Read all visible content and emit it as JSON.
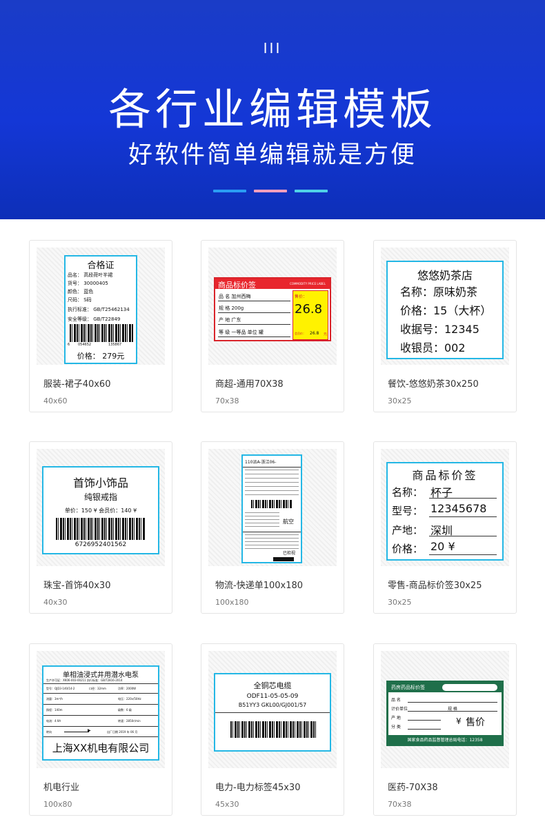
{
  "header": {
    "roman": "III",
    "title": "各行业编辑模板",
    "subtitle": "好软件简单编辑就是方便",
    "bar_colors": [
      "#2a9df4",
      "#f29ebd",
      "#4fd1e8"
    ]
  },
  "colors": {
    "accent": "#23b7e5",
    "banner": "#1437d6"
  },
  "cards": [
    {
      "name": "服装-裙子40x60",
      "size": "40x60",
      "template": {
        "title": "合格证",
        "lines": [
          "品名：  高段荷叶半裙",
          "货号：  30000405",
          "颜色：  蓝色",
          "尺码：  S码",
          "执行标准：  GB/T25462134",
          "安全等级：  GB/T22849"
        ],
        "barcode_nums": [
          "6",
          "054652",
          "135867"
        ],
        "price": "价格： 279元"
      }
    },
    {
      "name": "商超-通用70X38",
      "size": "70x38",
      "template": {
        "title": "商品标价签",
        "subtitle": "COMMODITY PRICE LABEL",
        "rows": [
          "品 名  加州西梅",
          "规 格  200g",
          "产 地  广东",
          "等 级  一等品  单位  罐"
        ],
        "price_label": "售价：",
        "price": "26.8",
        "small_price_label": "会员价：",
        "small_price": "26.8",
        "unit": "元"
      }
    },
    {
      "name": "餐饮-悠悠奶茶30x250",
      "size": "30x25",
      "template": {
        "title": "悠悠奶茶店",
        "lines": [
          "名称：原味奶茶",
          "价格：15（大杯）",
          "收据号：12345",
          "收银员：002"
        ]
      }
    },
    {
      "name": "珠宝-首饰40x30",
      "size": "40x30",
      "template": {
        "title": "首饰小饰品",
        "subtitle": "纯银戒指",
        "price_line": "单价：150 ¥   会员价：140 ¥",
        "barcode": "6726952401562"
      }
    },
    {
      "name": "物流-快递单100x180",
      "size": "100x180",
      "template": {
        "top": "110派A-浙江06-",
        "mid": "航空",
        "bottom": "已检视"
      }
    },
    {
      "name": "零售-商品标价签30x25",
      "size": "30x25",
      "template": {
        "title": "商品标价签",
        "rows": [
          {
            "label": "名称：",
            "value": "杯子"
          },
          {
            "label": "型号：",
            "value": "12345678"
          },
          {
            "label": "产地：",
            "value": "深圳"
          },
          {
            "label": "价格：",
            "value": "20 ¥"
          }
        ]
      }
    },
    {
      "name": "机电行业",
      "size": "100x80",
      "template": {
        "title": "单相油浸式井用潜水电泵",
        "meta": "生产许可证：XK06-003-00211     执行标准：GB/T2816-2014",
        "cells": [
          "型号：QJD3-140/14-2",
          "口径：32mm",
          "功率：2000W",
          "流量：3m³/h",
          "电压：220v/50Hz",
          "扬程：140m",
          "级数：6 级",
          "电流：4.9A",
          "转速：2850r/min",
          "转向",
          "出厂日期 2019 年 06 月"
        ],
        "company": "上海XX机电有限公司"
      }
    },
    {
      "name": "电力-电力标签45x30",
      "size": "45x30",
      "template": {
        "title": "全铜芯电缆",
        "line1": "ODF11-05-05-09",
        "line2": "B51YY3 GKL00/GJ001/57"
      }
    },
    {
      "name": "医药-70X38",
      "size": "70x38",
      "template": {
        "title": "药房药品标价签",
        "rows": [
          "品  名",
          "计价单位",
          "规  格",
          "产  地",
          "分  类"
        ],
        "price_symbol": "¥",
        "price_label": "售价",
        "footer": "国家食品药品监督管理总局电话：12358"
      }
    }
  ]
}
